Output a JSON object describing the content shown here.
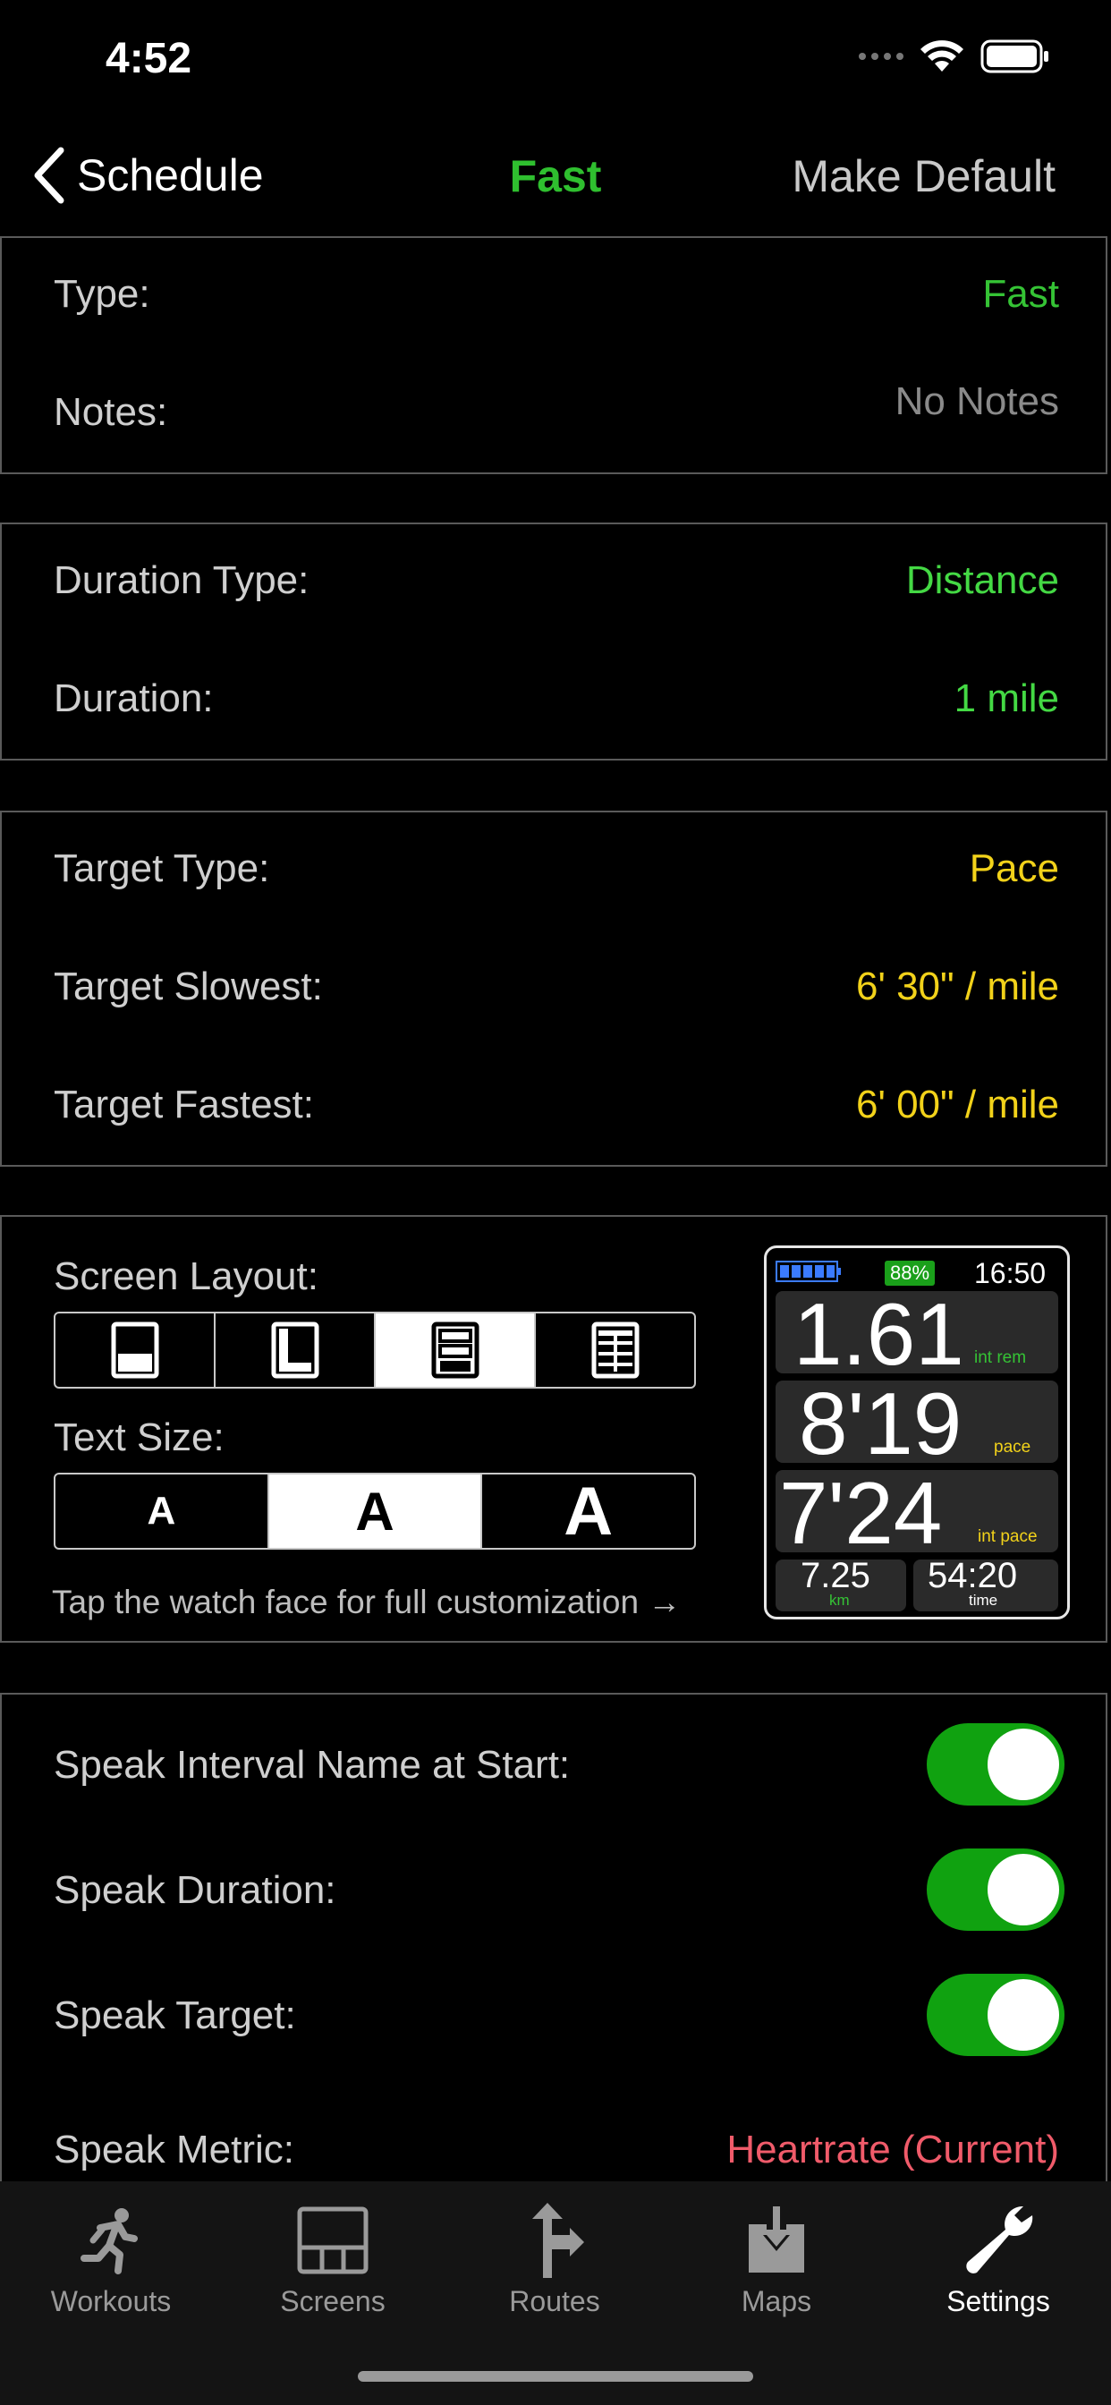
{
  "status": {
    "time": "4:52"
  },
  "nav": {
    "back_label": "Schedule",
    "title": "Fast",
    "right_action": "Make Default"
  },
  "info": {
    "type_label": "Type:",
    "type_value": "Fast",
    "notes_label": "Notes:",
    "notes_value": "No Notes"
  },
  "duration": {
    "type_label": "Duration Type:",
    "type_value": "Distance",
    "label": "Duration:",
    "value": "1 mile"
  },
  "target": {
    "type_label": "Target Type:",
    "type_value": "Pace",
    "slowest_label": "Target Slowest:",
    "slowest_value": "6' 30\" / mile",
    "fastest_label": "Target Fastest:",
    "fastest_value": "6' 00\" / mile"
  },
  "screen": {
    "layout_label": "Screen Layout:",
    "layout_selected_index": 2,
    "text_size_label": "Text Size:",
    "text_size_options": [
      "A",
      "A",
      "A"
    ],
    "text_size_selected_index": 1,
    "hint": "Tap the watch face for full customization →"
  },
  "watch": {
    "battery": "88%",
    "clock": "16:50",
    "field1_value": "1.61",
    "field1_label": "int rem",
    "field2_value": "8'19",
    "field2_label": "pace",
    "field3_value": "7'24",
    "field3_label": "int pace",
    "field4_value": "7.25",
    "field4_label": "km",
    "field5_value": "54:20",
    "field5_label": "time"
  },
  "speak": {
    "interval_name_label": "Speak Interval Name at Start:",
    "duration_label": "Speak Duration:",
    "target_label": "Speak Target:",
    "metric_label": "Speak Metric:",
    "metric_value": "Heartrate (Current)",
    "interval_name_on": true,
    "duration_on": true,
    "target_on": true
  },
  "tabs": [
    "Workouts",
    "Screens",
    "Routes",
    "Maps",
    "Settings"
  ],
  "colors": {
    "green": "#35c335",
    "yellow": "#f2d21a",
    "red": "#f05b6a",
    "toggle": "#10a210"
  }
}
